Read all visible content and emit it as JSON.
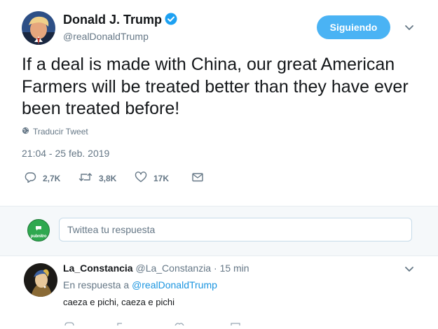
{
  "tweet": {
    "author_name": "Donald J. Trump",
    "author_handle": "@realDonaldTrump",
    "follow_label": "Siguiendo",
    "text": "If a deal is made with China, our great American Farmers will be treated better than they have ever been treated before!",
    "translate_label": "Traducir Tweet",
    "timestamp": "21:04 - 25 feb. 2019",
    "actions": {
      "replies": "2,7K",
      "retweets": "3,8K",
      "likes": "17K"
    }
  },
  "reply_box": {
    "avatar_label": "pubnitro",
    "placeholder": "Twittea tu respuesta"
  },
  "reply": {
    "author_name": "La_Constancia",
    "author_handle": "@La_Constanzia",
    "separator": "·",
    "time": "15 min",
    "replying_to_prefix": "En respuesta a",
    "replying_to_handle": "@realDonaldTrump",
    "text": "caeza e pichi, caeza e pichi"
  },
  "colors": {
    "accent": "#1b95e0",
    "follow_button": "#4ab3f4",
    "secondary_text": "#657786",
    "primary_text": "#14171a"
  }
}
